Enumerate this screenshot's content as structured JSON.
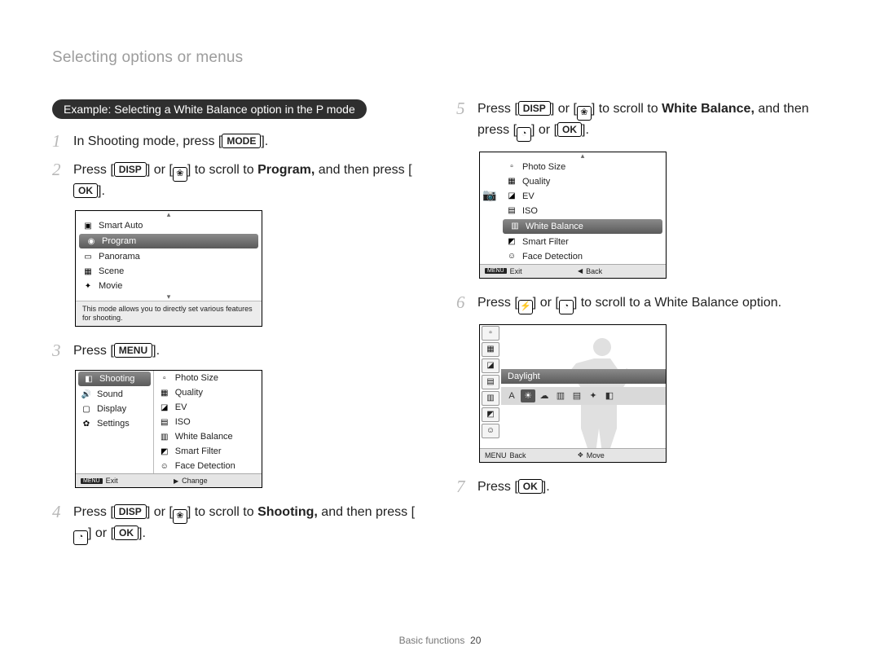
{
  "header": "Selecting options or menus",
  "example_pill": "Example: Selecting a White Balance option in the P mode",
  "keys": {
    "mode": "MODE",
    "disp": "DISP",
    "menu": "MENU",
    "ok": "OK"
  },
  "steps": {
    "s1_a": "In Shooting mode, press [",
    "s1_b": "].",
    "s2_a": "Press [",
    "s2_b": "] or [",
    "s2_c": "] to scroll to ",
    "s2_target": "Program,",
    "s2_d": " and then press [",
    "s2_e": "].",
    "s3_a": "Press [",
    "s3_b": "].",
    "s4_a": "Press [",
    "s4_b": "] or [",
    "s4_c": "] to scroll to ",
    "s4_target": "Shooting,",
    "s4_d": " and then press [",
    "s4_e": "] or [",
    "s4_f": "].",
    "s5_a": "Press [",
    "s5_b": "] or [",
    "s5_c": "] to scroll to ",
    "s5_target": "White Balance,",
    "s5_d": " and then press [",
    "s5_e": "] or [",
    "s5_f": "].",
    "s6_a": "Press [",
    "s6_b": "] or [",
    "s6_c": "] to scroll to a White Balance option.",
    "s7_a": "Press [",
    "s7_b": "]."
  },
  "screen_modes": {
    "items": [
      "Smart Auto",
      "Program",
      "Panorama",
      "Scene",
      "Movie"
    ],
    "selected_index": 1,
    "caption": "This mode allows you to directly set various features for shooting."
  },
  "screen_menu": {
    "left": [
      "Shooting",
      "Sound",
      "Display",
      "Settings"
    ],
    "left_selected_index": 0,
    "right": [
      "Photo Size",
      "Quality",
      "EV",
      "ISO",
      "White Balance",
      "Smart Filter",
      "Face Detection"
    ],
    "footer_left": "Exit",
    "footer_right": "Change"
  },
  "screen_wb_list": {
    "items": [
      "Photo Size",
      "Quality",
      "EV",
      "ISO",
      "White Balance",
      "Smart Filter",
      "Face Detection"
    ],
    "selected_index": 4,
    "footer_left": "Exit",
    "footer_right": "Back"
  },
  "screen_wb_select": {
    "label": "Daylight",
    "footer_left": "Back",
    "footer_right": "Move"
  },
  "footer": {
    "section": "Basic functions",
    "page": "20"
  }
}
